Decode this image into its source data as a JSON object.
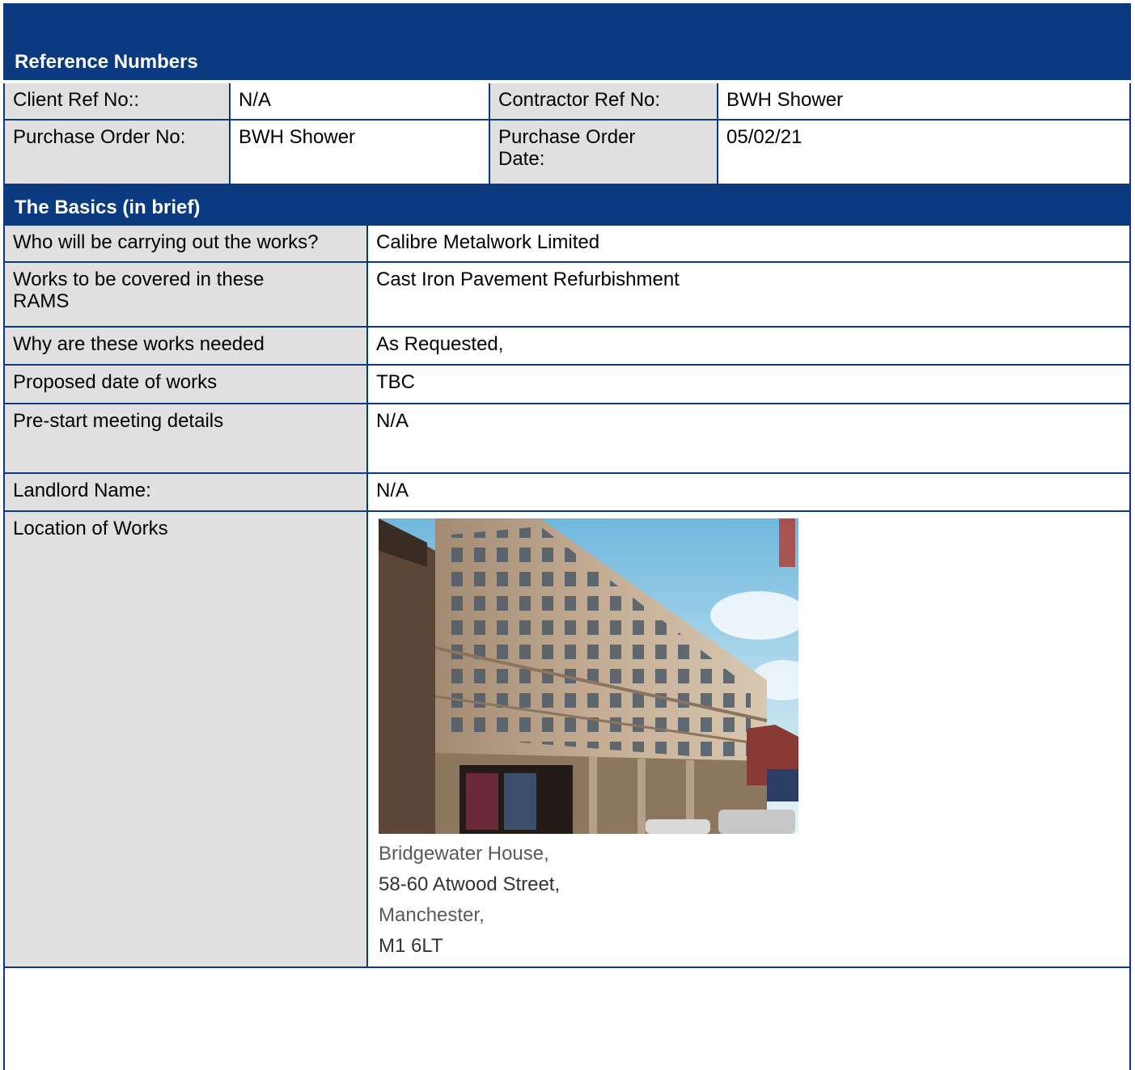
{
  "reference_section": {
    "title": "Reference Numbers",
    "client_ref_label": "Client Ref No::",
    "client_ref_value": "N/A",
    "contractor_ref_label": "Contractor Ref No:",
    "contractor_ref_value": "BWH Shower",
    "po_no_label": "Purchase Order No:",
    "po_no_value": "BWH Shower",
    "po_date_label": "Purchase Order Date:",
    "po_date_value": "05/02/21"
  },
  "basics_section": {
    "title": "The Basics (in brief)",
    "rows": [
      {
        "label": "Who will be carrying out the works?",
        "value": "Calibre Metalwork Limited"
      },
      {
        "label": "Works to be covered in these RAMS",
        "value": "Cast Iron Pavement Refurbishment"
      },
      {
        "label": "Why are these works needed",
        "value": "As Requested,"
      },
      {
        "label": "Proposed date of works",
        "value": "TBC"
      },
      {
        "label": "Pre-start meeting details",
        "value": "N/A"
      },
      {
        "label": "Landlord Name:",
        "value": "N/A"
      },
      {
        "label": "Location of Works",
        "value": ""
      }
    ],
    "address": {
      "line1": "Bridgewater House,",
      "line2": "58-60 Atwood Street,",
      "line3": "Manchester,",
      "line4": "M1 6LT"
    }
  },
  "colors": {
    "header_blue": "#0b3a80",
    "label_grey": "#e0e0e0"
  }
}
